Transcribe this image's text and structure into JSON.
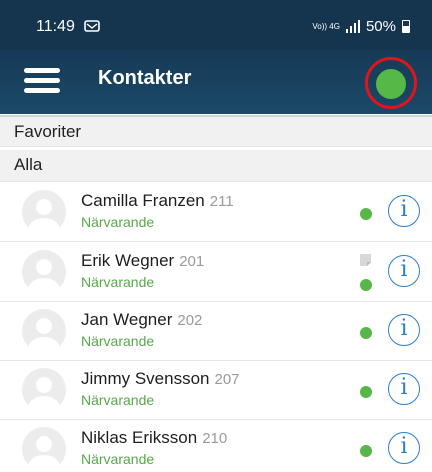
{
  "status_bar": {
    "time": "11:49",
    "network_label": "Vo)) 4G",
    "battery": "50%",
    "notification_icon": "message-notification-icon"
  },
  "header": {
    "title": "Kontakter",
    "menu_icon": "hamburger-menu-icon",
    "presence_color": "#54b947",
    "highlight_color": "#e0151c"
  },
  "sections": {
    "favorites": "Favoriter",
    "all": "Alla"
  },
  "contacts": [
    {
      "name": "Camilla Franzen",
      "ext": "211",
      "status": "Närvarande",
      "extra_icon": null
    },
    {
      "name": "Erik Wegner",
      "ext": "201",
      "status": "Närvarande",
      "extra_icon": "document-icon"
    },
    {
      "name": "Jan Wegner",
      "ext": "202",
      "status": "Närvarande",
      "extra_icon": null
    },
    {
      "name": "Jimmy Svensson",
      "ext": "207",
      "status": "Närvarande",
      "extra_icon": null
    },
    {
      "name": "Niklas Eriksson",
      "ext": "210",
      "status": "Närvarande",
      "extra_icon": null
    }
  ],
  "colors": {
    "header_bg": "#163a57",
    "present_green": "#57a94a",
    "info_blue": "#2b7fc8"
  }
}
